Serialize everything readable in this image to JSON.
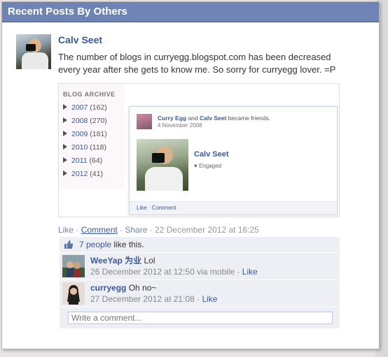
{
  "panel": {
    "title": "Recent Posts By Others"
  },
  "post": {
    "author": "Calv Seet",
    "message": "The number of blogs in curryegg.blogspot.com has been decreased every year after she gets to know me. So sorry for curryegg lover. =P",
    "shared_image": {
      "archive_title": "BLOG ARCHIVE",
      "archive": [
        {
          "year": "2007",
          "count": "(162)"
        },
        {
          "year": "2008",
          "count": "(270)"
        },
        {
          "year": "2009",
          "count": "(181)"
        },
        {
          "year": "2010",
          "count": "(118)"
        },
        {
          "year": "2011",
          "count": "(64)"
        },
        {
          "year": "2012",
          "count": "(41)"
        }
      ],
      "card": {
        "name1": "Curry Egg",
        "and_text": " and ",
        "name2": "Calv Seet",
        "became_text": " became friends.",
        "date": "4 November 2008",
        "profile_name": "Calv Seet",
        "status": "♥ Engaged",
        "actions": "Like · Comment"
      }
    },
    "actions": {
      "like": "Like",
      "sep1": " · ",
      "comment": "Comment",
      "sep2": " · ",
      "share": "Share",
      "timestamp": " · 22 December 2012 at 16:25"
    },
    "likes": {
      "count_text": "7 people",
      "suffix": " like this."
    },
    "comments": [
      {
        "author": "WeeYap 为业",
        "text": " Lol",
        "meta": "26 December 2012 at 12:50 via mobile · ",
        "like": "Like"
      },
      {
        "author": "curryegg",
        "text": " Oh no~",
        "meta": "27 December 2012 at 21:08 · ",
        "like": "Like"
      }
    ],
    "write_comment": {
      "placeholder": "Write a comment..."
    }
  },
  "colors": {
    "header": "#6d84b4",
    "link": "#3b5998",
    "feedback_bg": "#edeff4"
  }
}
